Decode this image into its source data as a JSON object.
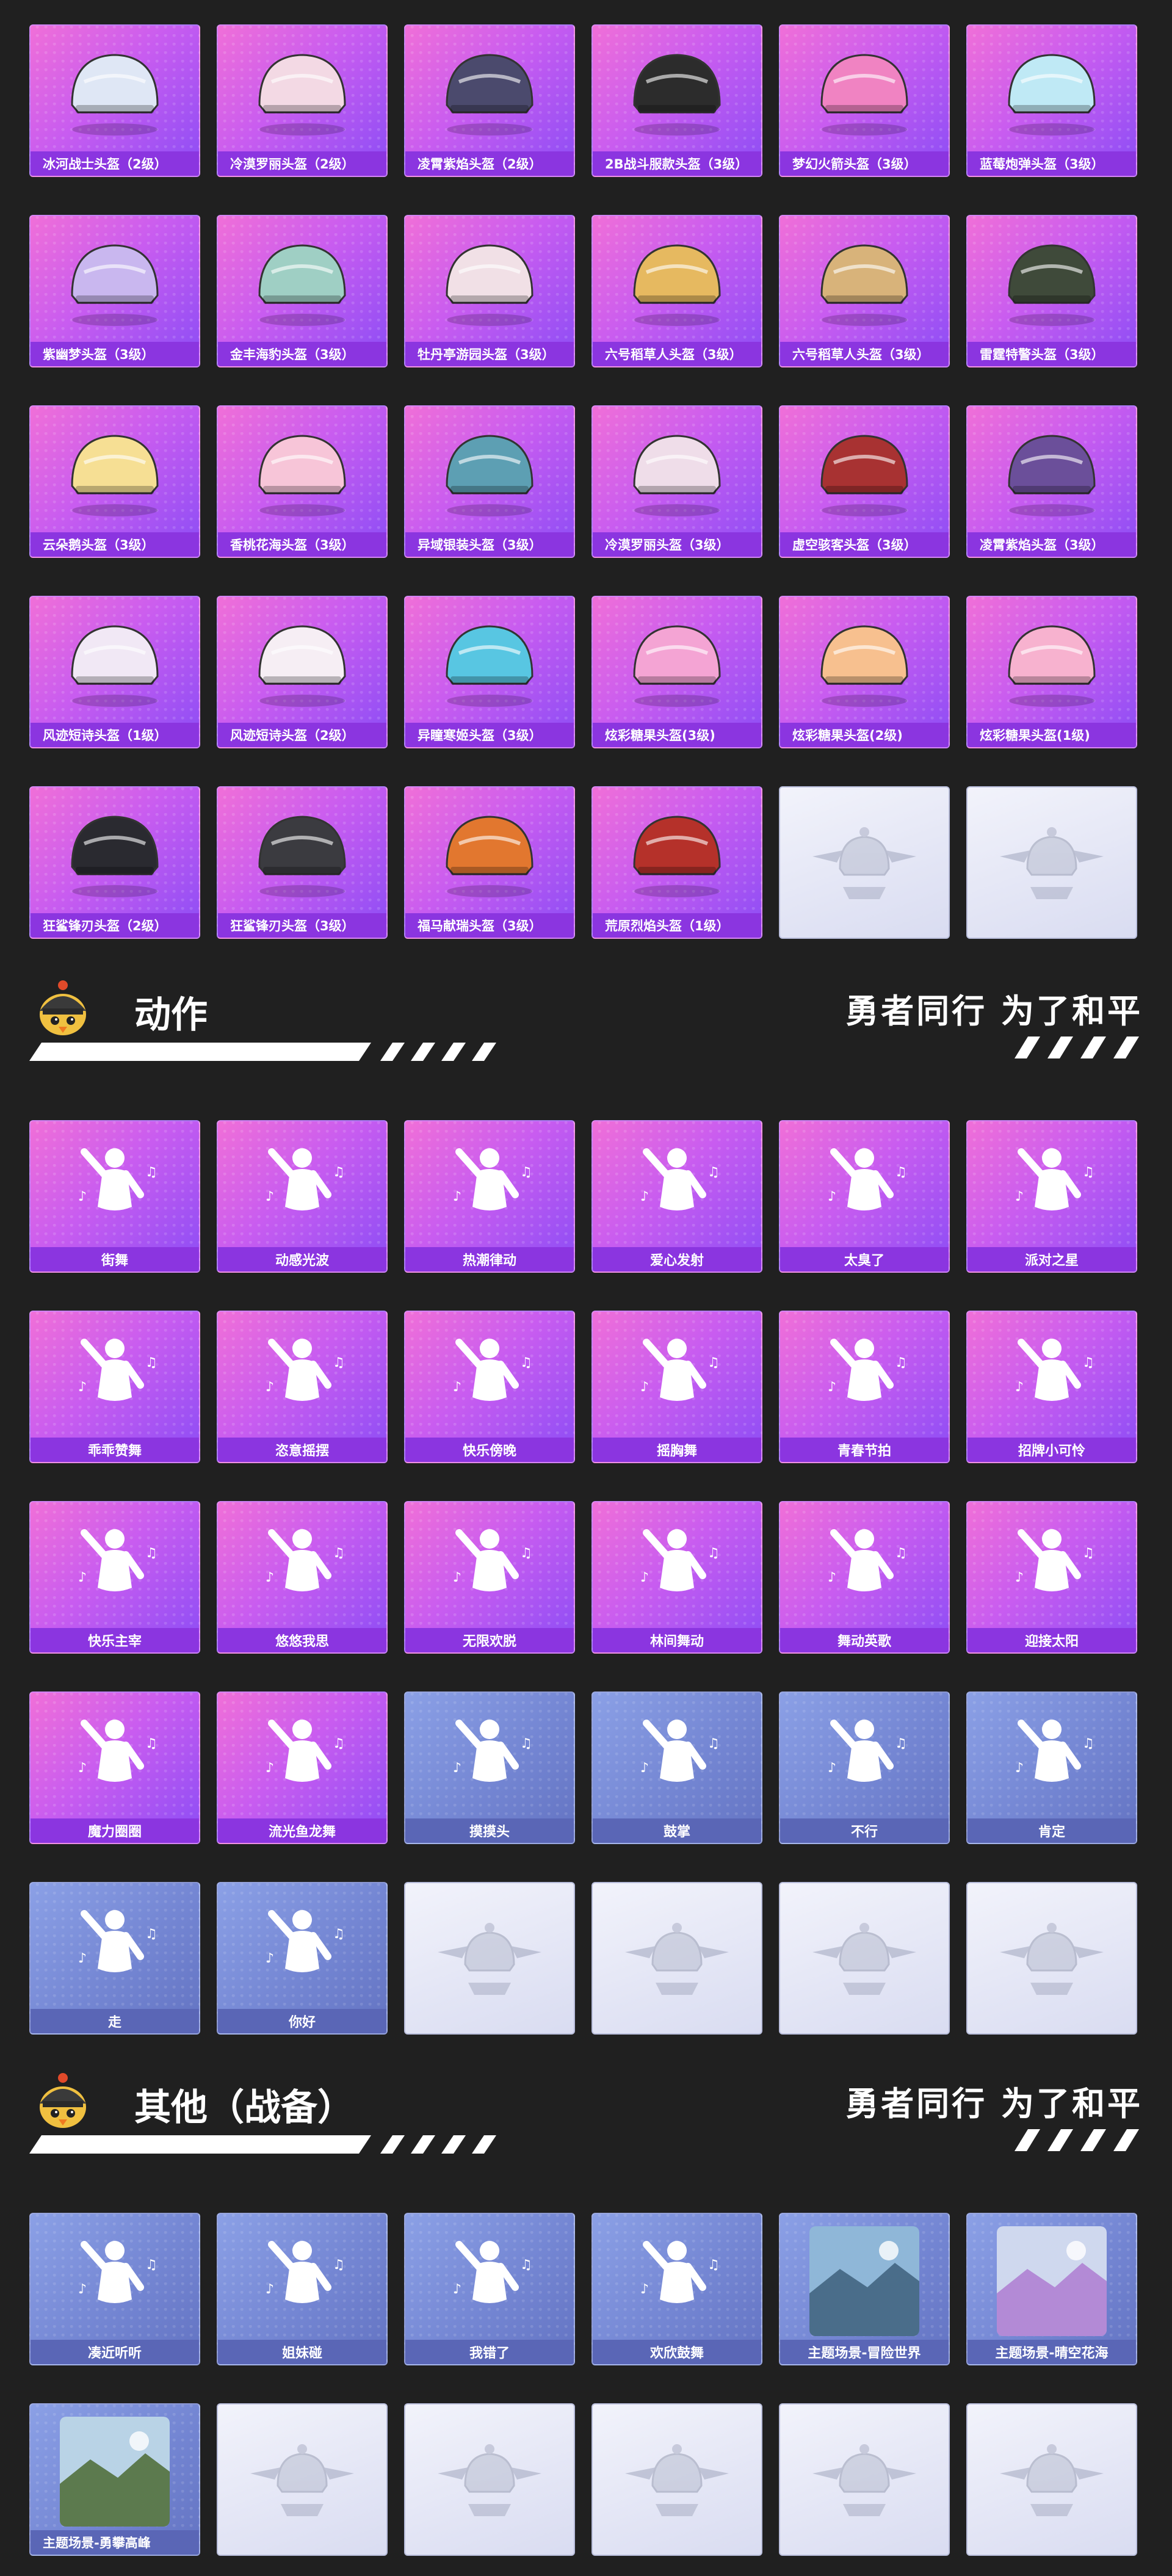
{
  "helmets": [
    "冰河战士头盔（2级）",
    "冷漠罗丽头盔（2级）",
    "凌霄紫焰头盔（2级）",
    "2B战斗服款头盔（3级）",
    "梦幻火箭头盔（3级）",
    "蓝莓炮弹头盔（3级）",
    "紫幽梦头盔（3级）",
    "金丰海豹头盔（3级）",
    "牡丹亭游园头盔（3级）",
    "六号稻草人头盔（3级）",
    "六号稻草人头盔（3级）",
    "雷霆特警头盔（3级）",
    "云朵鹅头盔（3级）",
    "香桃花海头盔（3级）",
    "异域银装头盔（3级）",
    "冷漠罗丽头盔（3级）",
    "虚空骇客头盔（3级）",
    "凌霄紫焰头盔（3级）",
    "风迹短诗头盔（1级）",
    "风迹短诗头盔（2级）",
    "异瞳寒姬头盔（3级）",
    "炫彩糖果头盔(3级)",
    "炫彩糖果头盔(2级)",
    "炫彩糖果头盔(1级)",
    "狂鲨锋刃头盔（2级）",
    "狂鲨锋刃头盔（3级）",
    "福马献瑞头盔（3级）",
    "荒原烈焰头盔（1级）",
    "",
    ""
  ],
  "section_actions": {
    "title": "动作",
    "slogan": "勇者同行 为了和平"
  },
  "actions_purple": [
    "街舞",
    "动感光波",
    "热潮律动",
    "爱心发射",
    "太臭了",
    "派对之星",
    "乖乖赞舞",
    "恣意摇摆",
    "快乐傍晚",
    "摇胸舞",
    "青春节拍",
    "招牌小可怜",
    "快乐主宰",
    "悠悠我思",
    "无限欢脱",
    "林间舞动",
    "舞动英歌",
    "迎接太阳",
    "魔力圈圈",
    "流光鱼龙舞"
  ],
  "actions_blue": [
    "摸摸头",
    "鼓掌",
    "不行",
    "肯定",
    "走",
    "你好"
  ],
  "section_other": {
    "title": "其他（战备）",
    "slogan": "勇者同行 为了和平"
  },
  "other_blue": [
    "凑近听听",
    "姐妹碰",
    "我错了",
    "欢欣鼓舞"
  ],
  "other_scenes": [
    "主题场景-冒险世界",
    "主题场景-晴空花海",
    "主题场景-勇攀高峰"
  ],
  "colors": {
    "background": "#202020",
    "purple_tile": "#c85cf0",
    "purple_label": "#8b35e0",
    "blue_tile": "#7486d3",
    "blue_label": "#5a66b6",
    "empty_tile": "#e3e5f5"
  },
  "icons": {
    "helmet": "helmet-icon",
    "dance": "dancer-silhouette-icon",
    "empty": "placeholder-emblem-icon",
    "mascot": "chicken-helmet-mascot-icon"
  }
}
